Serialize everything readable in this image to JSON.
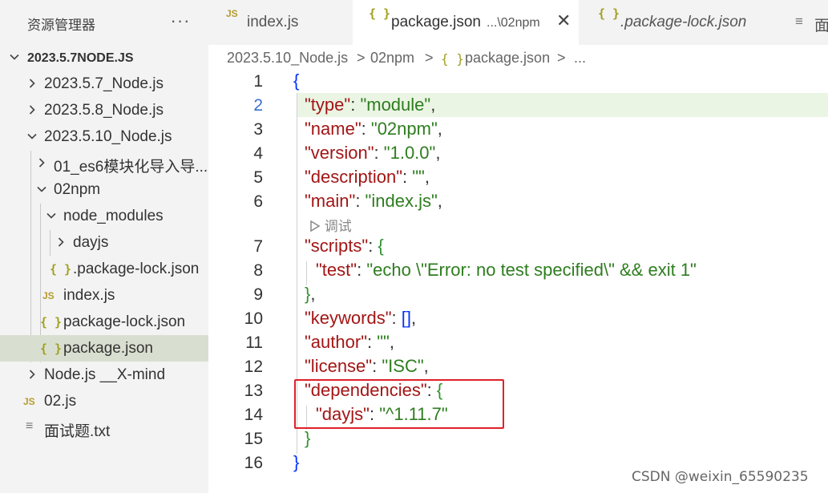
{
  "sidebar": {
    "title": "资源管理器",
    "more": "···",
    "workspace": "2023.5.7NODE.JS",
    "tree": [
      {
        "label": "2023.5.7_Node.js",
        "type": "folder",
        "expanded": false
      },
      {
        "label": "2023.5.8_Node.js",
        "type": "folder",
        "expanded": false
      },
      {
        "label": "2023.5.10_Node.js",
        "type": "folder",
        "expanded": true
      },
      {
        "label": "01_es6模块化导入导...",
        "type": "folder",
        "expanded": false
      },
      {
        "label": "02npm",
        "type": "folder",
        "expanded": true
      },
      {
        "label": "node_modules",
        "type": "folder",
        "expanded": true
      },
      {
        "label": "dayjs",
        "type": "folder",
        "expanded": false
      },
      {
        "label": ".package-lock.json",
        "type": "json",
        "icon": "{ }"
      },
      {
        "label": "index.js",
        "type": "js",
        "icon": "JS"
      },
      {
        "label": "package-lock.json",
        "type": "json",
        "icon": "{ }"
      },
      {
        "label": "package.json",
        "type": "json",
        "icon": "{ }",
        "selected": true
      },
      {
        "label": "Node.js __X-mind",
        "type": "folder",
        "expanded": false
      },
      {
        "label": "02.js",
        "type": "js",
        "icon": "JS"
      },
      {
        "label": "面试题.txt",
        "type": "txt",
        "icon": "≡"
      }
    ]
  },
  "tabs": [
    {
      "icon": "JS",
      "label": "index.js"
    },
    {
      "icon": "{ }",
      "label": "package.json",
      "description": "...\\02npm",
      "close": "✕",
      "active": true
    },
    {
      "icon": "{ }",
      "label": ".package-lock.json"
    },
    {
      "icon": "≡",
      "label": "面"
    }
  ],
  "breadcrumb": {
    "parts": [
      "2023.5.10_Node.js",
      ">",
      "02npm",
      ">",
      "{ }",
      "package.json",
      ">",
      "..."
    ]
  },
  "editor": {
    "line_numbers": [
      "1",
      "2",
      "3",
      "4",
      "5",
      "6",
      "7",
      "8",
      "9",
      "10",
      "11",
      "12",
      "13",
      "14",
      "15",
      "16"
    ],
    "active_line": "2",
    "codelens": "调试",
    "lines": [
      {
        "open": "{"
      },
      {
        "key": "\"type\"",
        "colon": ": ",
        "value": "\"module\"",
        "tail": ","
      },
      {
        "key": "\"name\"",
        "colon": ": ",
        "value": "\"02npm\"",
        "tail": ","
      },
      {
        "key": "\"version\"",
        "colon": ": ",
        "value": "\"1.0.0\"",
        "tail": ","
      },
      {
        "key": "\"description\"",
        "colon": ": ",
        "value": "\"\"",
        "tail": ","
      },
      {
        "key": "\"main\"",
        "colon": ": ",
        "value": "\"index.js\"",
        "tail": ","
      },
      {
        "key": "\"scripts\"",
        "colon": ": ",
        "open": "{"
      },
      {
        "key": "\"test\"",
        "colon": ": ",
        "value": "\"echo \\\"Error: no test specified\\\" && exit 1\""
      },
      {
        "close": "}",
        "tail": ","
      },
      {
        "key": "\"keywords\"",
        "colon": ": ",
        "value": "[]",
        "tail": ","
      },
      {
        "key": "\"author\"",
        "colon": ": ",
        "value": "\"\"",
        "tail": ","
      },
      {
        "key": "\"license\"",
        "colon": ": ",
        "value": "\"ISC\"",
        "tail": ","
      },
      {
        "key": "\"dependencies\"",
        "colon": ": ",
        "open": "{"
      },
      {
        "key": "\"dayjs\"",
        "colon": ": ",
        "value": "\"^1.11.7\""
      },
      {
        "close": "}"
      },
      {
        "close": "}"
      }
    ]
  },
  "watermark": "CSDN @weixin_65590235",
  "colors": {
    "highlight_box": "#e0202a",
    "json_key": "#a31515",
    "json_string": "#2e7d1f",
    "bracket_level1": "#0431fa",
    "bracket_level2": "#319331"
  }
}
